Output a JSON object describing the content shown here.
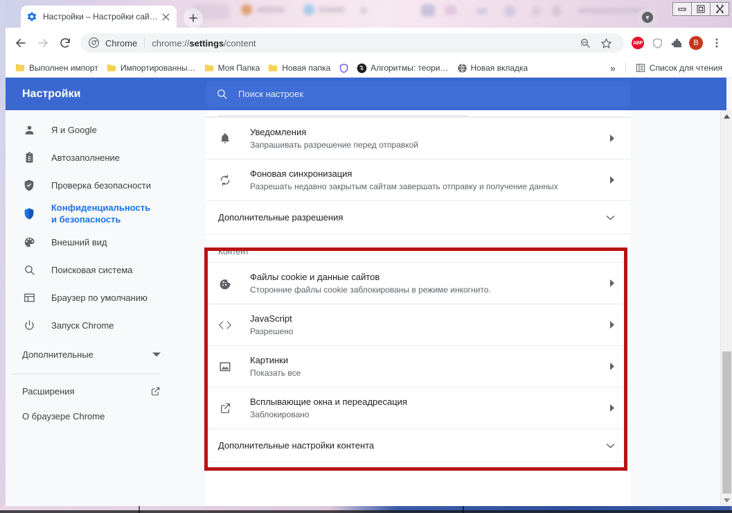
{
  "window": {
    "controls": {
      "minimize": "—",
      "maximize": "❐",
      "close": "✕"
    }
  },
  "tabstrip": {
    "tab": {
      "title": "Настройки – Настройки сайтов",
      "favicon": "settings-gear-icon",
      "close": "✕"
    },
    "new_tab_label": "+",
    "avatar_label": "▼"
  },
  "toolbar": {
    "back": "←",
    "forward": "→",
    "reload": "⟳",
    "omnibox": {
      "scheme_label": "Chrome",
      "url_prefix": "chrome://",
      "url_bold": "settings",
      "url_suffix": "/content",
      "zoom_icon": "zoom-out-icon",
      "bookmark_icon": "star-icon"
    },
    "extensions": [
      {
        "name": "abp-extension-icon",
        "label": "ABP"
      },
      {
        "name": "shield-extension-icon",
        "label": ""
      },
      {
        "name": "puzzle-extensions-icon",
        "label": ""
      }
    ],
    "profile_letter": "B",
    "menu_icon": "⋮"
  },
  "bookmarks": {
    "items": [
      {
        "label": "Выполнен импорт",
        "icon": "folder-icon"
      },
      {
        "label": "Импортированны…",
        "icon": "folder-icon"
      },
      {
        "label": "Моя Папка",
        "icon": "folder-icon"
      },
      {
        "label": "Новая папка",
        "icon": "folder-icon"
      },
      {
        "label": "",
        "icon": "shield-bookmark-icon"
      },
      {
        "label": "Алгоритмы: теори…",
        "icon": "site-favicon-icon"
      },
      {
        "label": "Новая вкладка",
        "icon": "globe-icon"
      }
    ],
    "overflow_label": "»",
    "reading_list_label": "Список для чтения"
  },
  "settings": {
    "title": "Настройки",
    "search_placeholder": "Поиск настроек",
    "sidebar": {
      "items": [
        {
          "label": "Я и Google",
          "icon": "person-icon",
          "active": false
        },
        {
          "label": "Автозаполнение",
          "icon": "clipboard-icon",
          "active": false
        },
        {
          "label": "Проверка безопасности",
          "icon": "shield-check-icon",
          "active": false
        },
        {
          "label": "Конфиденциальность и безопасность",
          "icon": "shield-icon",
          "active": true
        },
        {
          "label": "Внешний вид",
          "icon": "palette-icon",
          "active": false
        },
        {
          "label": "Поисковая система",
          "icon": "search-icon",
          "active": false
        },
        {
          "label": "Браузер по умолчанию",
          "icon": "browser-icon",
          "active": false
        },
        {
          "label": "Запуск Chrome",
          "icon": "power-icon",
          "active": false
        }
      ],
      "advanced_label": "Дополнительные",
      "extensions_label": "Расширения",
      "about_label": "О браузере Chrome"
    },
    "permissions_rows": [
      {
        "title": "Уведомления",
        "sub": "Запрашивать разрешение перед отправкой",
        "icon": "bell-icon",
        "arrow": "▸"
      },
      {
        "title": "Фоновая синхронизация",
        "sub": "Разрешать недавно закрытым сайтам завершать отправку и получение данных",
        "icon": "sync-icon",
        "arrow": "▸"
      }
    ],
    "additional_permissions_label": "Дополнительные разрешения",
    "additional_permissions_caret": "⌄",
    "content_group_label": "Контент",
    "content_rows": [
      {
        "title": "Файлы cookie и данные сайтов",
        "sub": "Сторонние файлы cookie заблокированы в режиме инкогнито.",
        "icon": "cookie-icon",
        "arrow": "▸"
      },
      {
        "title": "JavaScript",
        "sub": "Разрешено",
        "icon": "code-icon",
        "arrow": "▸"
      },
      {
        "title": "Картинки",
        "sub": "Показать все",
        "icon": "image-icon",
        "arrow": "▸"
      },
      {
        "title": "Всплывающие окна и переадресация",
        "sub": "Заблокировано",
        "icon": "popup-icon",
        "arrow": "▸"
      }
    ],
    "additional_content_label": "Дополнительные настройки контента",
    "additional_content_caret": "⌄"
  },
  "scrollbar": {
    "up": "▲",
    "down": "▼"
  },
  "colors": {
    "header_blue": "#3b68d0",
    "accent_blue": "#1a73e8",
    "highlight_red": "#b81414",
    "text_primary": "#202124",
    "text_secondary": "#5f6368"
  }
}
